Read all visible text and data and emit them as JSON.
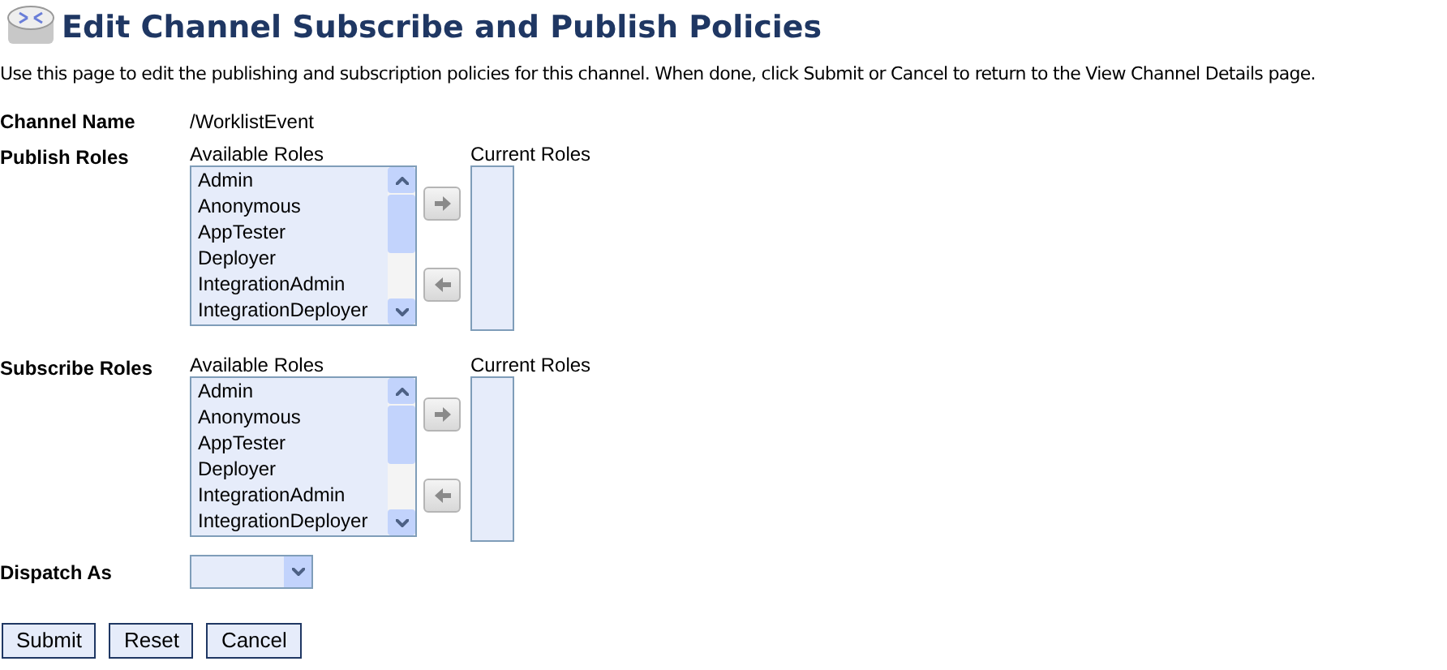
{
  "title": "Edit Channel Subscribe and Publish Policies",
  "description": "Use this page to edit the publishing and subscription policies for this channel. When done, click Submit or Cancel to return to the View Channel Details page.",
  "channel_name": {
    "label": "Channel Name",
    "value": "/WorklistEvent"
  },
  "role_sections": [
    {
      "label": "Publish Roles",
      "available_heading": "Available Roles",
      "current_heading": "Current Roles",
      "available": [
        "Admin",
        "Anonymous",
        "AppTester",
        "Deployer",
        "IntegrationAdmin",
        "IntegrationDeployer"
      ]
    },
    {
      "label": "Subscribe Roles",
      "available_heading": "Available Roles",
      "current_heading": "Current Roles",
      "available": [
        "Admin",
        "Anonymous",
        "AppTester",
        "Deployer",
        "IntegrationAdmin",
        "IntegrationDeployer"
      ]
    }
  ],
  "dispatch_as": {
    "label": "Dispatch As"
  },
  "buttons": [
    "Submit",
    "Reset",
    "Cancel"
  ]
}
